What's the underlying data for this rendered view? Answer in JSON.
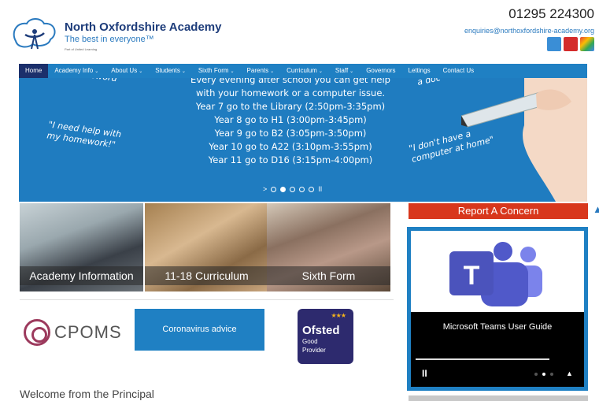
{
  "header": {
    "school_name": "North Oxfordshire Academy",
    "tagline": "The best in everyone™",
    "part_of": "Part of United Learning",
    "phone": "01295 224300",
    "email": "enquiries@northoxfordshire-academy.org",
    "social": [
      "twitter-icon",
      "youtube-icon",
      "google-plus-icon"
    ]
  },
  "nav": {
    "items": [
      {
        "label": "Home",
        "active": true
      },
      {
        "label": "Academy Info",
        "caret": "⌄"
      },
      {
        "label": "About Us",
        "caret": "⌄"
      },
      {
        "label": "Students",
        "caret": "⌄"
      },
      {
        "label": "Sixth Form",
        "caret": "⌄"
      },
      {
        "label": "Parents",
        "caret": "⌄"
      },
      {
        "label": "Curriculum",
        "caret": "⌄"
      },
      {
        "label": "Staff",
        "caret": "⌄"
      },
      {
        "label": "Governors"
      },
      {
        "label": "Lettings"
      },
      {
        "label": "Contact Us"
      }
    ]
  },
  "hero": {
    "lines": [
      "Every evening after school you can get help",
      "with your homework or a computer issue.",
      "Year 7 go to the Library (2:50pm-3:35pm)",
      "Year 8 go to H1 (3:00pm-3:45pm)",
      "Year 9 go to B2 (3:05pm-3:50pm)",
      "Year 10 go to A22 (3:10pm-3:55pm)",
      "Year 11 go to D16 (3:15pm-4:00pm)"
    ],
    "quote_password": "ssword\"",
    "quote_homework": "\"I need help with my homework!\"",
    "quote_adoc": "a doc",
    "quote_computer": "\"I don't have a computer at home\"",
    "next_glyph": ">",
    "pause_glyph": "II"
  },
  "tiles": [
    {
      "caption": "Academy Information"
    },
    {
      "caption": "11-18 Curriculum"
    },
    {
      "caption": "Sixth Form"
    }
  ],
  "logos": {
    "cpoms": "CPOMS",
    "coronavirus": "Coronavirus advice",
    "ofsted_stars": "★★★",
    "ofsted_name": "Ofsted",
    "ofsted_line1": "Good",
    "ofsted_line2": "Provider"
  },
  "welcome": "Welcome from the Principal",
  "sidebar": {
    "report": "Report A Concern",
    "teams_title": "Microsoft Teams User Guide",
    "teams_pause": "II",
    "teams_up": "▲"
  },
  "colors": {
    "brand_blue": "#1f80c3",
    "nav_active": "#1b2f6b",
    "report_red": "#d8371c",
    "ofsted_navy": "#2d2a6e"
  }
}
